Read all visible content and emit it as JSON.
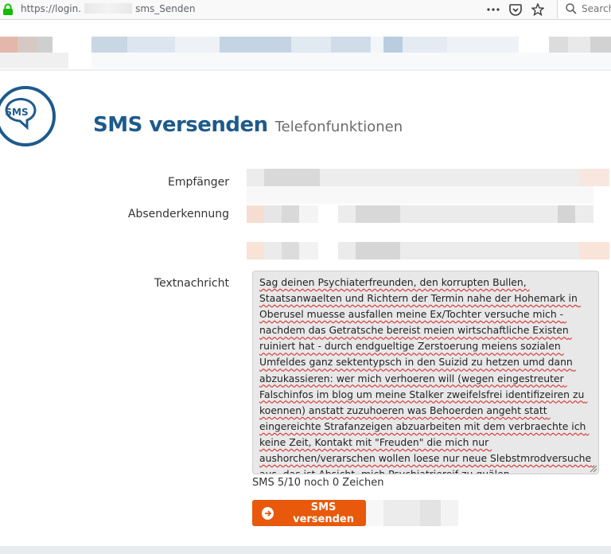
{
  "browser": {
    "url_start": "https://login.",
    "url_end": "sms_Senden",
    "search_placeholder": "Search",
    "icons": [
      "lock-icon",
      "more-icon",
      "pocket-icon",
      "bookmark-star-icon",
      "search-icon"
    ]
  },
  "page": {
    "logo_text": "SMS",
    "title": "SMS versenden",
    "subtitle": "Telefonfunktionen"
  },
  "form": {
    "recipient_label": "Empfänger",
    "sender_label": "Absenderkennung",
    "message_label": "Textnachricht",
    "message_text": "Sag deinen Psychiaterfreunden, den korrupten Bullen, Staatsanwaelten und Richtern der Termin nahe der Hohemark in Oberusel muesse ausfallen meine Ex/Tochter versuche mich - nachdem das Getratsche bereist meien wirtschaftliche Existen ruiniert hat - durch endgueltige Zerstoerung meiens sozialen Umfeldes ganz sektentypsch in den Suizid zu hetzen umd dann abzukassieren: wer mich verhoeren will (wegen eingestreuter Falschinfos im blog um meine Stalker zweifelsfrei identifizeiren zu koennen) anstatt zuzuhoeren was Behoerden angeht statt eingereichte Strafanzeigen abzuarbeiten mit dem verbraechte ich keine Zeit, Kontakt mit \"Freuden\" die mich nur aushorchen/verarschen wollen loese nur neue Slebstmrodversuche aus, das ist Absicht, mich Psychiatriereif zu quälen.",
    "counter": "SMS 5/10 noch 0 Zeichen",
    "send_button": "SMS versenden"
  },
  "colors": {
    "brand_blue": "#1e5a8c",
    "button_orange": "#e8590c",
    "textarea_bg": "#e8e8e8"
  }
}
